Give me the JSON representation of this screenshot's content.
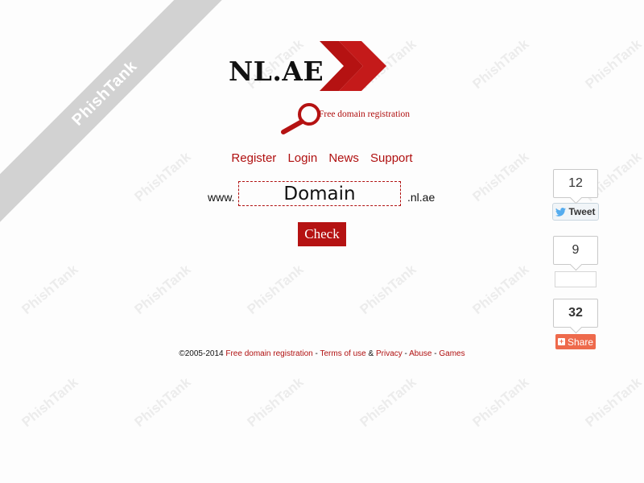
{
  "watermark": {
    "text": "PhishTank"
  },
  "banner": {
    "label": "PhishTank"
  },
  "logo": {
    "name": "NL.AE",
    "tagline": "Free domain registration"
  },
  "nav": {
    "items": [
      "Register",
      "Login",
      "News",
      "Support"
    ]
  },
  "domain_form": {
    "prefix": "www.",
    "input_placeholder": "Domain",
    "suffix": ".nl.ae",
    "check_label": "Check"
  },
  "social": {
    "twitter_count": "12",
    "tweet_label": "Tweet",
    "second_count": "9",
    "share_count": "32",
    "share_label": "Share"
  },
  "footer": {
    "copyright": "©2005-2014",
    "link_free_registration": "Free domain registration",
    "sep1": "-",
    "link_terms": "Terms of use",
    "amp": "&",
    "link_privacy": "Privacy",
    "sep2": "-",
    "link_abuse": "Abuse",
    "sep3": "-",
    "link_games": "Games"
  },
  "colors": {
    "accent": "#b51212",
    "link": "#b01010",
    "share": "#ee6a4c",
    "banner": "#d2d2d2"
  }
}
